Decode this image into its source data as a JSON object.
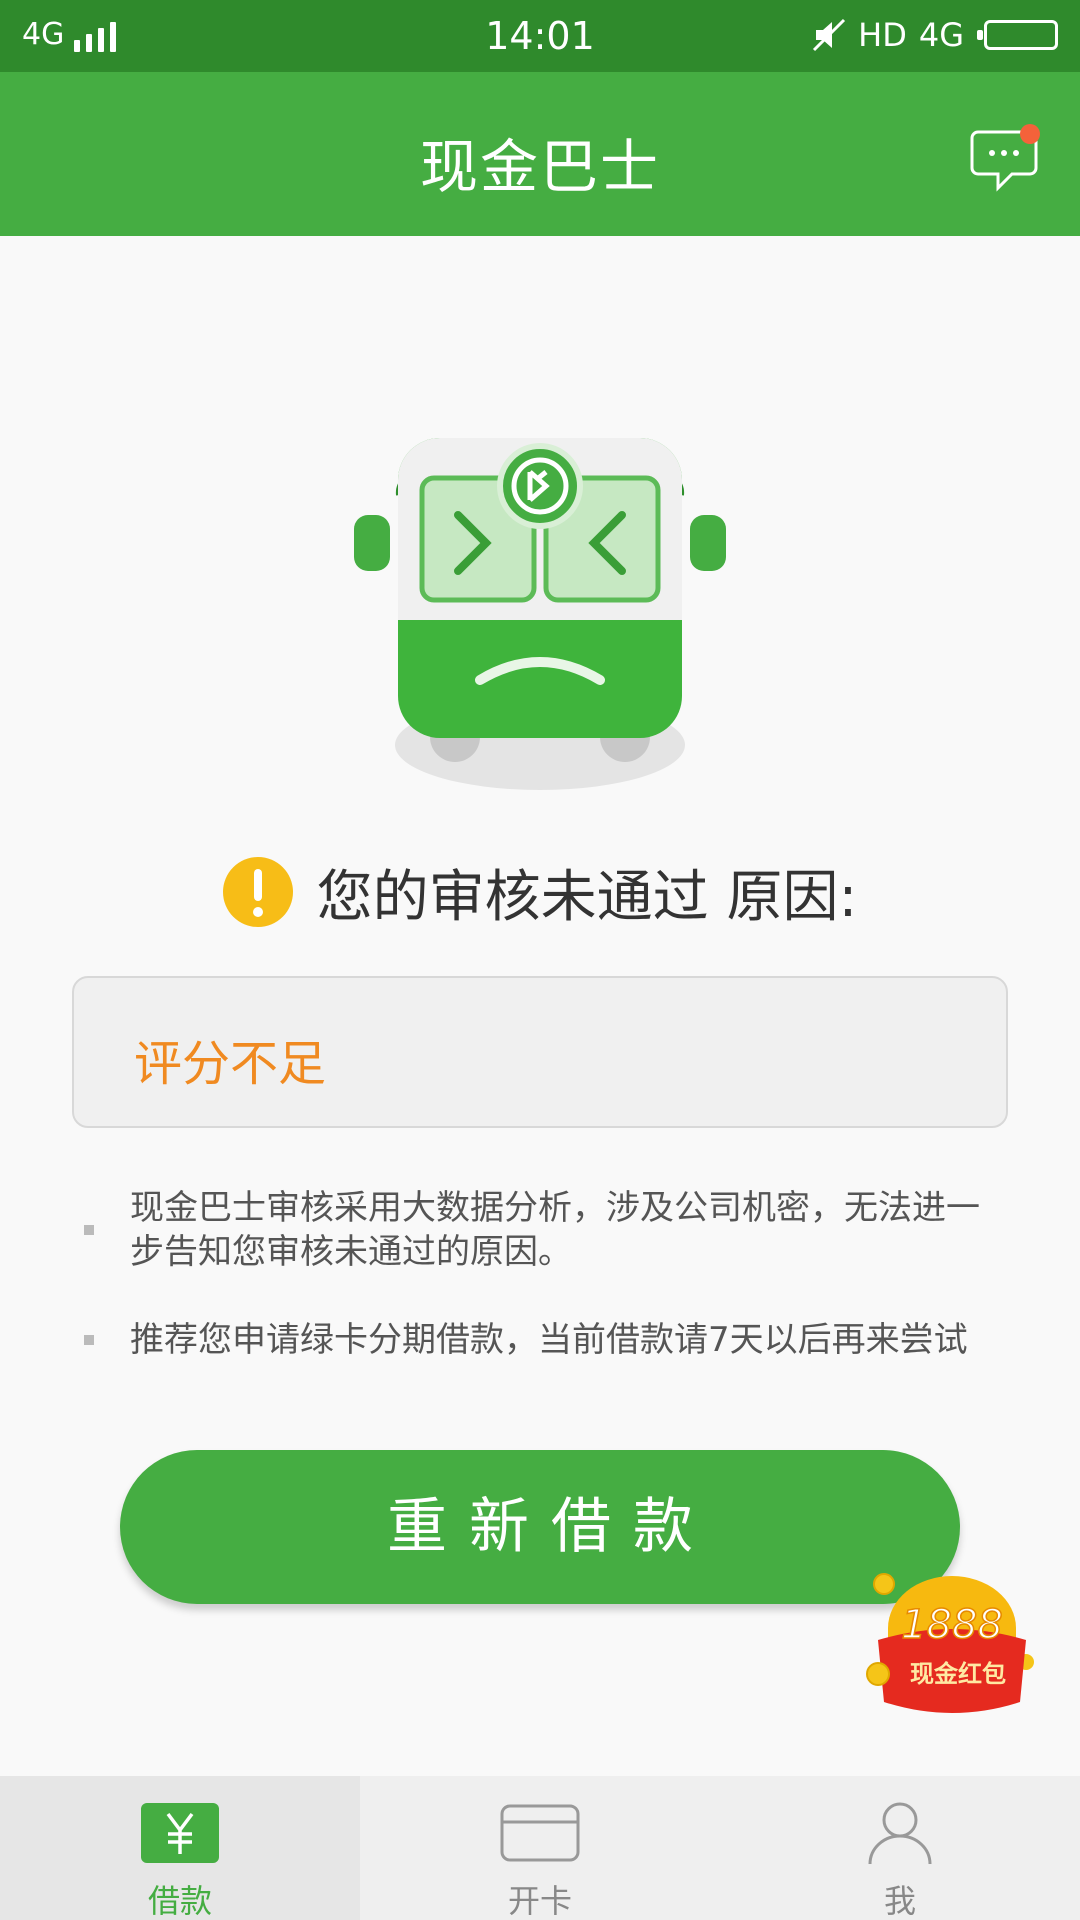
{
  "status_bar": {
    "network": "4G",
    "time": "14:01",
    "hd": "HD",
    "network_right": "4G"
  },
  "header": {
    "title": "现金巴士",
    "chat_icon": "chat-bubble-icon",
    "has_notification": true
  },
  "result": {
    "warning_text": "您的审核未通过 原因:",
    "reason": "评分不足"
  },
  "notes": [
    {
      "text": "现金巴士审核采用大数据分析，涉及公司机密，无法进一步告知您审核未通过的原因。"
    },
    {
      "text": "推荐您申请绿卡分期借款，当前借款请7天以后再来尝试"
    }
  ],
  "actions": {
    "retry_label": "重新借款"
  },
  "promo": {
    "amount": "1888",
    "label": "现金红包"
  },
  "tabbar": {
    "items": [
      {
        "label": "借款",
        "icon": "yuan-icon",
        "active": true
      },
      {
        "label": "开卡",
        "icon": "card-icon",
        "active": false
      },
      {
        "label": "我",
        "icon": "person-icon",
        "active": false
      }
    ]
  },
  "colors": {
    "brand_green": "#45ad42",
    "status_green": "#2f8a2c",
    "reason_orange": "#f08a21",
    "warning_yellow": "#f7bd17"
  }
}
